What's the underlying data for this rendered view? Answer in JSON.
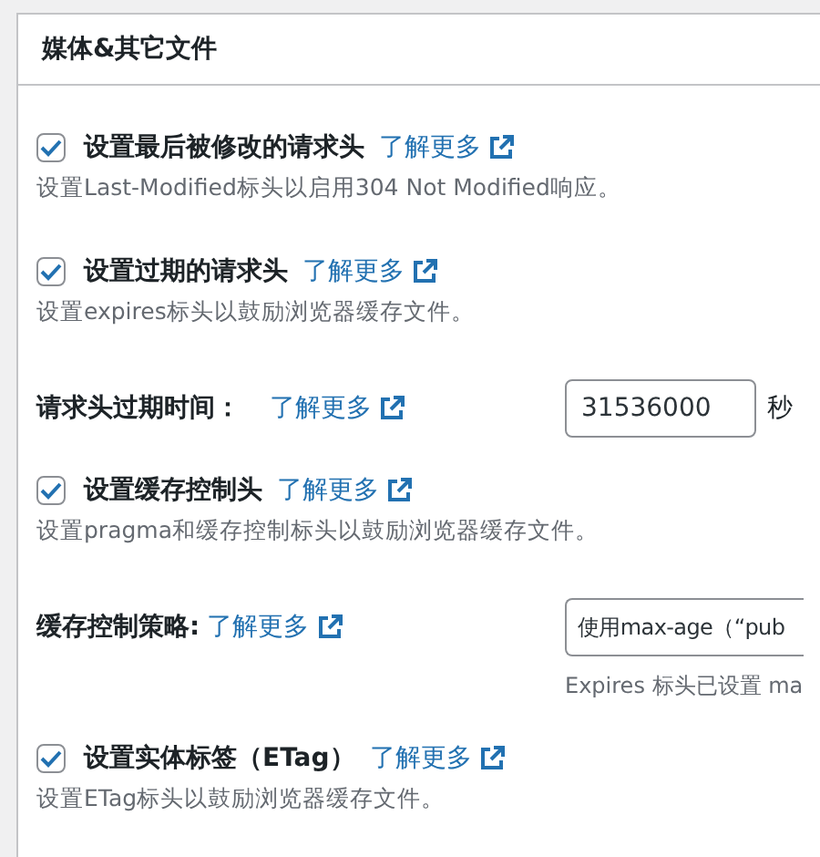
{
  "panel": {
    "title": "媒体&其它文件",
    "items": [
      {
        "kind": "checkbox",
        "label": "设置最后被修改的请求头",
        "checked": true,
        "link": "了解更多",
        "description": "设置Last-Modified标头以启用304 Not Modified响应。"
      },
      {
        "kind": "checkbox",
        "label": "设置过期的请求头",
        "checked": true,
        "link": "了解更多",
        "description": "设置expires标头以鼓励浏览器缓存文件。"
      },
      {
        "kind": "number",
        "label": "请求头过期时间：",
        "link": "了解更多",
        "value": "31536000",
        "unit": "秒"
      },
      {
        "kind": "checkbox",
        "label": "设置缓存控制头",
        "checked": true,
        "link": "了解更多",
        "description": "设置pragma和缓存控制标头以鼓励浏览器缓存文件。"
      },
      {
        "kind": "select",
        "label": "缓存控制策略:",
        "link": "了解更多",
        "value": "使用max-age（“pub",
        "hint": "Expires 标头已设置 ma"
      },
      {
        "kind": "checkbox",
        "label": "设置实体标签（ETag）",
        "checked": true,
        "link": "了解更多",
        "description": "设置ETag标头以鼓励浏览器缓存文件。"
      }
    ]
  }
}
